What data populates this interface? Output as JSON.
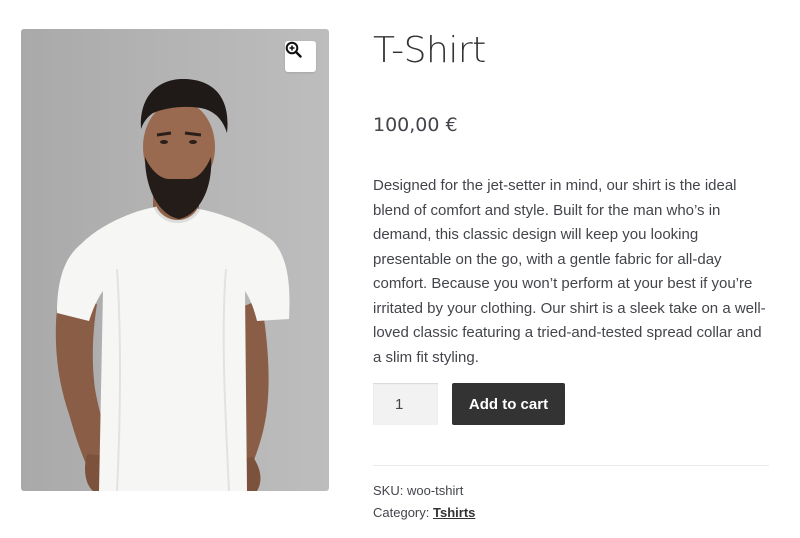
{
  "product": {
    "image_alt": "T-Shirt",
    "zoom_icon": "zoom-in-icon",
    "title": "T-Shirt",
    "price": "100,00 €",
    "description": "Designed for the jet-setter in mind, our shirt is the ideal blend of comfort and style. Built for the man who’s in demand, this classic design will keep you looking presentable on the go, with a gentle fabric for all-day comfort. Because you won’t perform at your best if you’re irritated by your clothing. Our shirt is a sleek take on a well-loved classic featuring a tried-and-tested spread collar and a slim fit styling.",
    "quantity": "1",
    "add_to_cart_label": "Add to cart",
    "sku_label": "SKU:",
    "sku_value": "woo-tshirt",
    "category_label": "Category:",
    "category_value": "Tshirts"
  },
  "colors": {
    "button_bg": "#333333",
    "button_text": "#ffffff",
    "text": "#43454b",
    "image_bg": "#b3b3b4"
  }
}
